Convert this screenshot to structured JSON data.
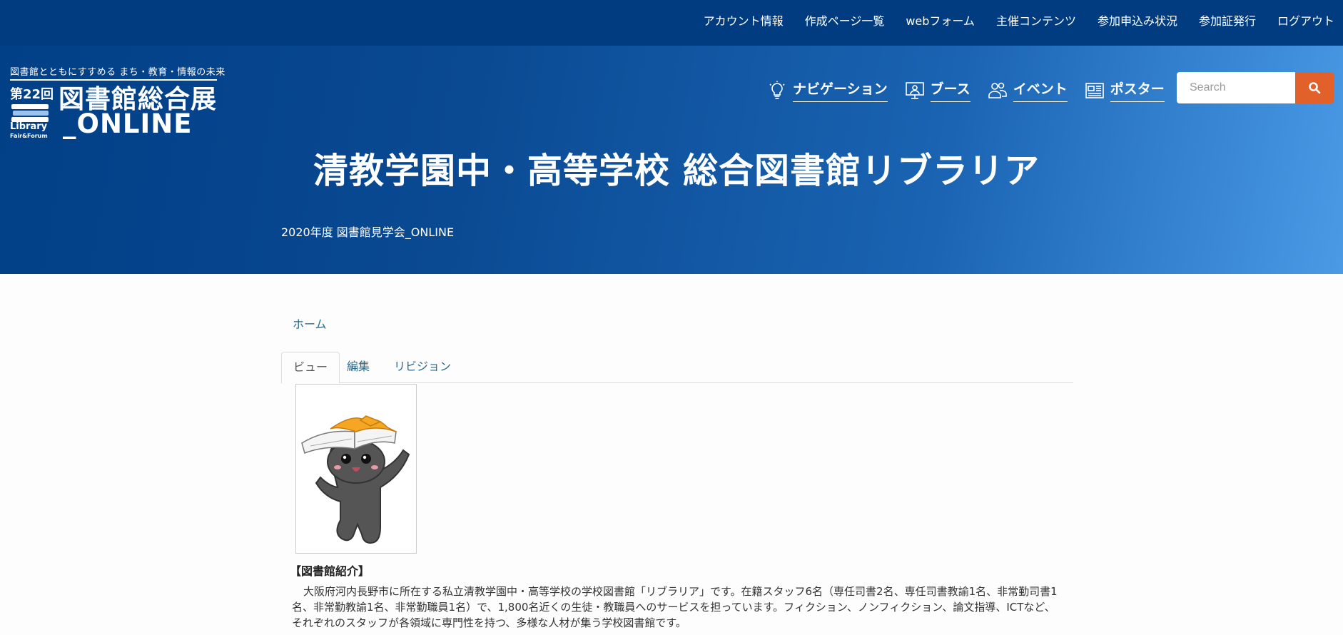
{
  "topnav": {
    "items": [
      "アカウント情報",
      "作成ページ一覧",
      "webフォーム",
      "主催コンテンツ",
      "参加申込み状況",
      "参加証発行",
      "ログアウト"
    ]
  },
  "logo": {
    "tagline": "図書館とともにすすめる まち・教育・情報の未来",
    "edition": "第22回",
    "title": "図書館総合展",
    "online": "_ONLINE",
    "library": "Library",
    "fair": "Fair&Forum"
  },
  "mainnav": [
    {
      "label": "ナビゲーション",
      "icon": "lightbulb-icon"
    },
    {
      "label": "ブース",
      "icon": "presenter-icon"
    },
    {
      "label": "イベント",
      "icon": "people-icon"
    },
    {
      "label": "ポスター",
      "icon": "newspaper-icon"
    }
  ],
  "search": {
    "placeholder": "Search",
    "icon": "search-icon"
  },
  "hero": {
    "title": "清教学園中・高等学校 総合図書館リブラリア",
    "subtitle": "2020年度 図書館見学会_ONLINE"
  },
  "breadcrumb": {
    "home": "ホーム"
  },
  "tabs": [
    "ビュー",
    "編集",
    "リビジョン"
  ],
  "content": {
    "image_alt": "cat-mascot-with-book",
    "heading": "【図書館紹介】",
    "body": "大阪府河内長野市に所在する私立清教学園中・高等学校の学校図書館「リブラリア」です。在籍スタッフ6名（専任司書2名、専任司書教諭1名、非常勤司書1名、非常勤教諭1名、非常勤職員1名）で、1,800名近くの生徒・教職員へのサービスを担っています。フィクション、ノンフィクション、論文指導、ICTなど、それぞれのスタッフが各領域に専門性を持つ、多様な人材が集う学校図書館です。"
  },
  "colors": {
    "topbar": "#013c80",
    "search_button": "#e2602a",
    "link": "#2c6a89"
  }
}
